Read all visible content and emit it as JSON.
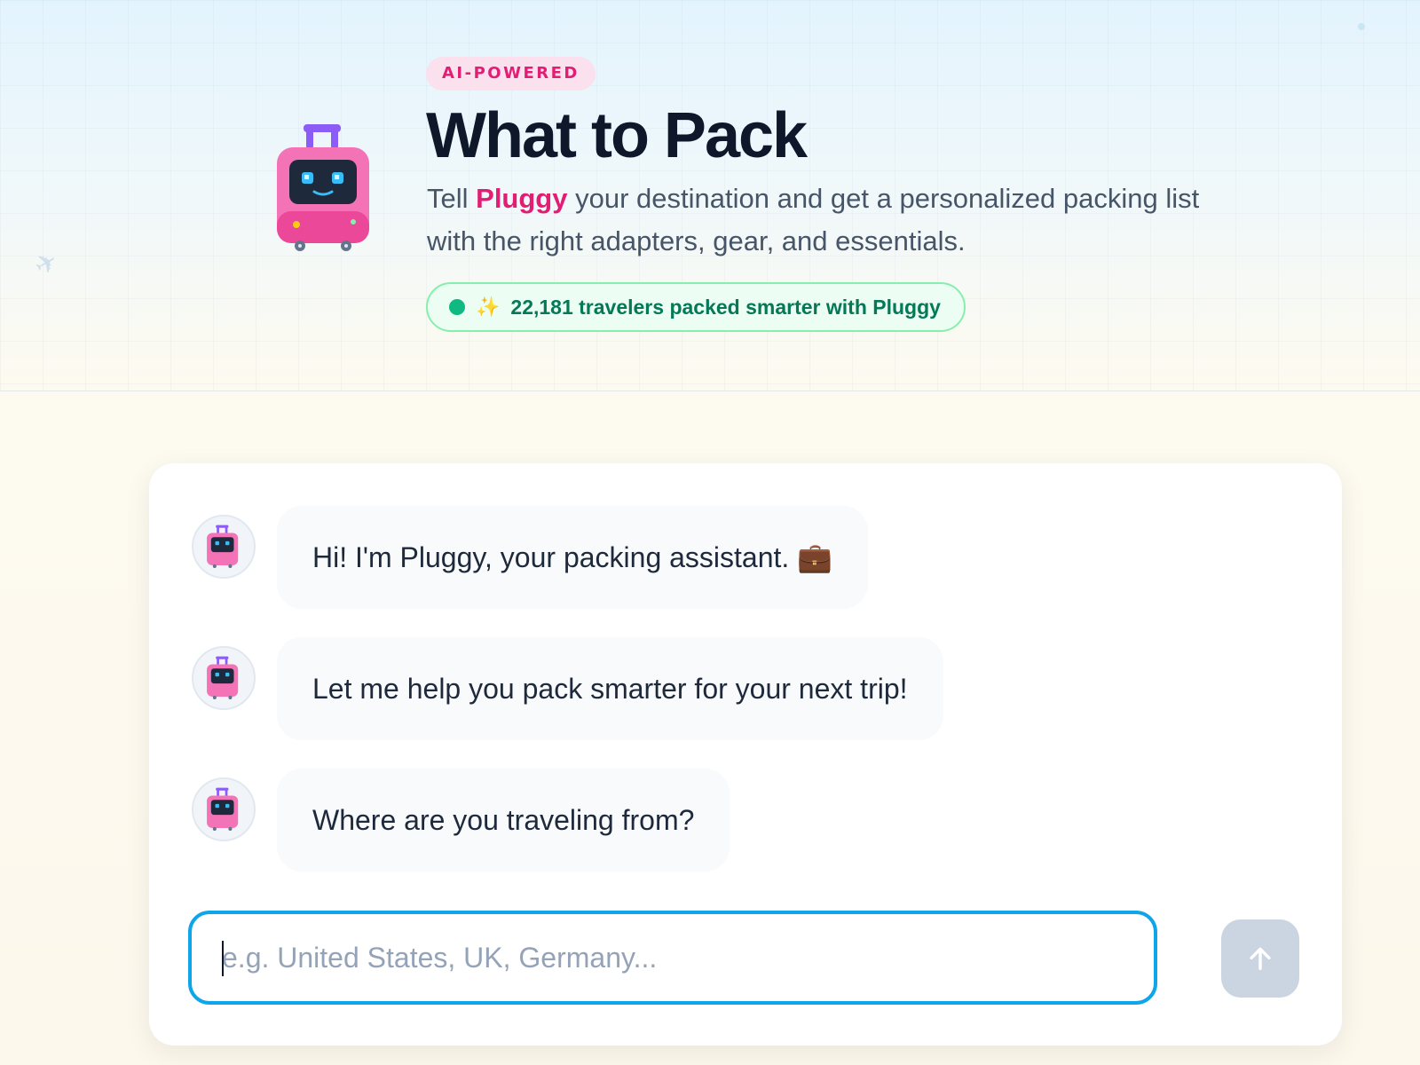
{
  "hero": {
    "badge": "AI-POWERED",
    "title": "What to Pack",
    "subtitle": {
      "prefix": "Tell ",
      "brand": "Pluggy",
      "suffix": " your destination and get a personalized packing list with the right adapters, gear, and essentials."
    },
    "stats": {
      "sparkle": "✨",
      "text": "22,181 travelers packed smarter with Pluggy",
      "status_color": "#10b981"
    },
    "decor_icons": [
      "airplane-icon"
    ]
  },
  "chat": {
    "messages": [
      {
        "sender": "assistant",
        "text": "Hi! I'm Pluggy, your packing assistant. 💼"
      },
      {
        "sender": "assistant",
        "text": "Let me help you pack smarter for your next trip!"
      },
      {
        "sender": "assistant",
        "text": "Where are you traveling from?"
      }
    ],
    "input": {
      "value": "",
      "placeholder": "e.g. United States, UK, Germany..."
    },
    "send_icon": "arrow-up-icon"
  },
  "colors": {
    "accent": "#e11d74",
    "focus_ring": "#0ea5e9",
    "title": "#0f172a",
    "success": "#047857"
  }
}
